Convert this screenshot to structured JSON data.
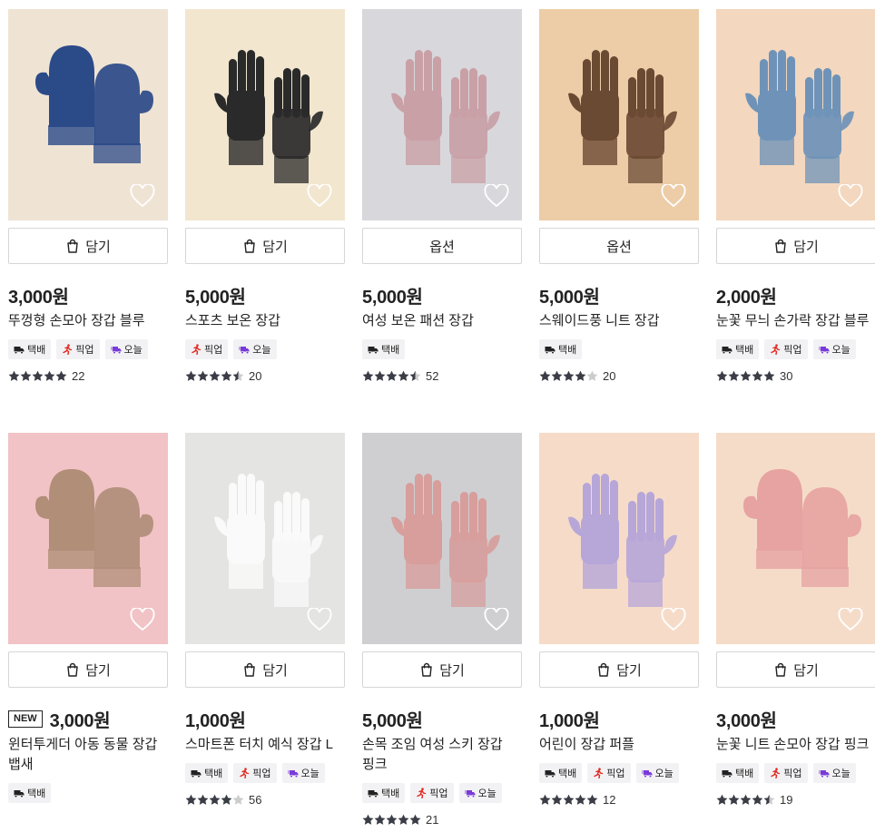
{
  "products": [
    {
      "cta": "담기",
      "cta_type": "cart",
      "new": false,
      "price": "3,000원",
      "name": "뚜껑형 손모아 장갑 블루",
      "tags": [
        "택배",
        "픽업",
        "오늘"
      ],
      "rating": 5,
      "reviews": "22",
      "bg": "#efe3d4",
      "color": "#2b4a88"
    },
    {
      "cta": "담기",
      "cta_type": "cart",
      "new": false,
      "price": "5,000원",
      "name": "스포츠 보온 장갑",
      "tags": [
        "픽업",
        "오늘"
      ],
      "rating": 4.5,
      "reviews": "20",
      "bg": "#f2e6cf",
      "color": "#2a2a2a"
    },
    {
      "cta": "옵션",
      "cta_type": "option",
      "new": false,
      "price": "5,000원",
      "name": "여성 보온 패션 장갑",
      "tags": [
        "택배"
      ],
      "rating": 4.5,
      "reviews": "52",
      "bg": "#d8d8dc",
      "color": "#c9a0a6"
    },
    {
      "cta": "옵션",
      "cta_type": "option",
      "new": false,
      "price": "5,000원",
      "name": "스웨이드풍 니트 장갑",
      "tags": [
        "택배"
      ],
      "rating": 4,
      "reviews": "20",
      "bg": "#eccda7",
      "color": "#6b4a34"
    },
    {
      "cta": "담기",
      "cta_type": "cart",
      "new": false,
      "price": "2,000원",
      "name": "눈꽃 무늬 손가락 장갑 블루",
      "tags": [
        "택배",
        "픽업",
        "오늘"
      ],
      "rating": 5,
      "reviews": "30",
      "bg": "#f3d7be",
      "color": "#6f93b8"
    },
    {
      "cta": "담기",
      "cta_type": "cart",
      "new": true,
      "price": "3,000원",
      "name": "윈터투게더 아동 동물 장갑 뱁새",
      "tags": [
        "택배"
      ],
      "rating": 0,
      "reviews": "",
      "bg": "#f1c3c6",
      "color": "#b08e78"
    },
    {
      "cta": "담기",
      "cta_type": "cart",
      "new": false,
      "price": "1,000원",
      "name": "스마트폰 터치 예식 장갑 L",
      "tags": [
        "택배",
        "픽업",
        "오늘"
      ],
      "rating": 4,
      "reviews": "56",
      "bg": "#e4e4e2",
      "color": "#fafafa"
    },
    {
      "cta": "담기",
      "cta_type": "cart",
      "new": false,
      "price": "5,000원",
      "name": "손목 조임 여성 스키 장갑 핑크",
      "tags": [
        "택배",
        "픽업",
        "오늘"
      ],
      "rating": 5,
      "reviews": "21",
      "bg": "#cfcfd2",
      "color": "#d79e9c"
    },
    {
      "cta": "담기",
      "cta_type": "cart",
      "new": false,
      "price": "1,000원",
      "name": "어린이 장갑 퍼플",
      "tags": [
        "택배",
        "픽업",
        "오늘"
      ],
      "rating": 5,
      "reviews": "12",
      "bg": "#f6dcc8",
      "color": "#b7a6d8"
    },
    {
      "cta": "담기",
      "cta_type": "cart",
      "new": false,
      "price": "3,000원",
      "name": "눈꽃 니트 손모아 장갑 핑크",
      "tags": [
        "택배",
        "픽업",
        "오늘"
      ],
      "rating": 4.5,
      "reviews": "19",
      "bg": "#f5dcc9",
      "color": "#e6a3a1"
    }
  ],
  "icons": {
    "cart": "shopping-bag-icon",
    "heart": "heart-outline-icon",
    "delivery": "truck-icon",
    "pickup": "runner-icon",
    "today": "fast-truck-icon",
    "star": "star-icon"
  },
  "colors": {
    "pickup": "#e2261f",
    "today": "#7a3ad9",
    "star": "#3a3d46"
  }
}
